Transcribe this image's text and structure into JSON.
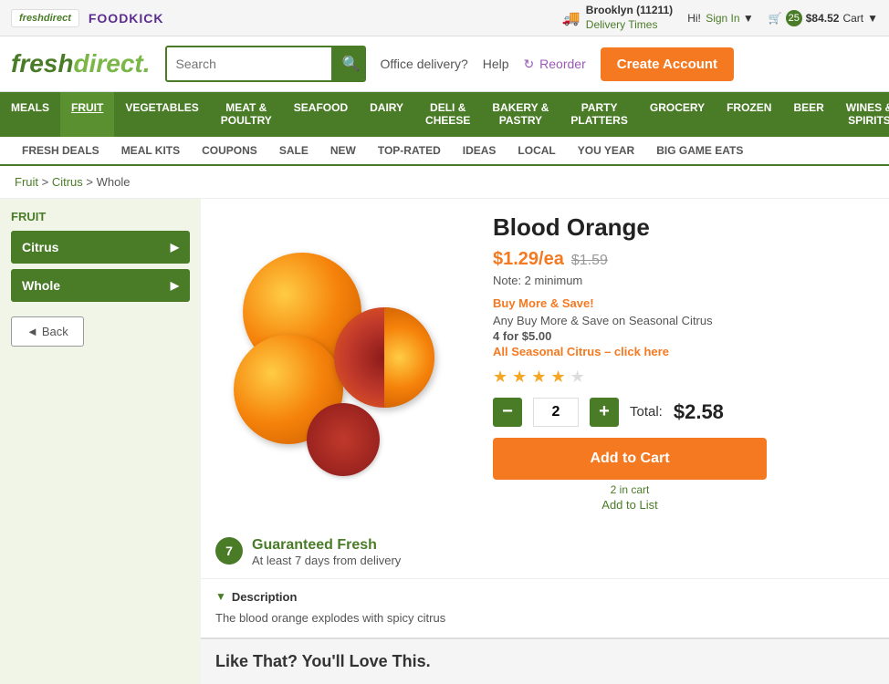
{
  "topbar": {
    "logo_fresh": "freshdirect",
    "logo_foodkick": "FOODKICK",
    "delivery": {
      "city": "Brooklyn (11211)",
      "label": "Delivery Times",
      "icon": "🚚"
    },
    "greeting": "Hi!",
    "signin_label": "Sign In",
    "cart_count": "25",
    "cart_price": "$84.52",
    "cart_label": "Cart"
  },
  "header": {
    "logo_fresh": "fresh",
    "logo_direct": "direct.",
    "search_placeholder": "Search",
    "search_btn": "🔍",
    "links": {
      "office": "Office delivery?",
      "help": "Help",
      "reorder_icon": "↻",
      "reorder": "Reorder"
    },
    "create_account": "Create Account"
  },
  "nav": {
    "items": [
      {
        "label": "MEALS"
      },
      {
        "label": "FRUIT",
        "active": true
      },
      {
        "label": "VEGETABLES"
      },
      {
        "label": "MEAT &\nPOULTRY"
      },
      {
        "label": "SEAFOOD"
      },
      {
        "label": "DAIRY"
      },
      {
        "label": "DELI &\nCHEESE"
      },
      {
        "label": "BAKERY &\nPASTRY"
      },
      {
        "label": "PARTY\nPLATTERS"
      },
      {
        "label": "GROCERY"
      },
      {
        "label": "FROZEN"
      },
      {
        "label": "BEER"
      },
      {
        "label": "WINES &\nSPIRITS"
      }
    ]
  },
  "subnav": {
    "items": [
      "FRESH DEALS",
      "MEAL KITS",
      "COUPONS",
      "SALE",
      "NEW",
      "TOP-RATED",
      "IDEAS",
      "LOCAL",
      "YOU YEAR",
      "BIG GAME EATS"
    ]
  },
  "sidebar": {
    "title": "FRUIT",
    "items": [
      {
        "label": "Citrus"
      },
      {
        "label": "Whole"
      }
    ],
    "back_label": "◄  Back"
  },
  "breadcrumb": {
    "parts": [
      "Fruit",
      "Citrus",
      "Whole"
    ]
  },
  "product": {
    "title": "Blood Orange",
    "price_current": "$1.29/ea",
    "price_original": "$1.59",
    "note": "Note: 2 minimum",
    "promo_title": "Buy More & Save!",
    "promo_line1": "Any Buy More & Save on Seasonal Citrus",
    "promo_line2": "4 for $5.00",
    "promo_link": "All Seasonal Citrus – click here",
    "stars": 4,
    "max_stars": 5,
    "quantity": "2",
    "total_label": "Total:",
    "total_price": "$2.58",
    "add_to_cart": "Add to Cart",
    "in_cart": "2 in cart",
    "add_to_list": "Add to List"
  },
  "guaranteed": {
    "badge": "7",
    "title": "Guaranteed Fresh",
    "subtitle": "At least 7 days from delivery"
  },
  "description": {
    "title": "Description",
    "text": "The blood orange explodes with spicy citrus"
  },
  "like_that": {
    "title": "Like That? You'll Love This."
  }
}
